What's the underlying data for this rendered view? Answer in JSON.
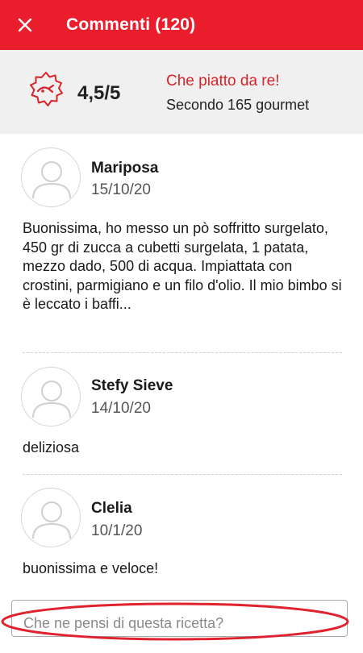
{
  "header": {
    "title": "Commenti (120)",
    "close_icon": "close-icon",
    "background": "#ea1d2c"
  },
  "rating": {
    "icon": "medal-icon",
    "value": "4,5/5",
    "phrase": "Che piatto da re!",
    "count_text": "Secondo 165 gourmet",
    "accent": "#d8232a"
  },
  "comments": [
    {
      "author": "Mariposa",
      "date": "15/10/20",
      "text": "Buonissima, ho messo un pò soffritto surgelato, 450 gr di zucca a cubetti surgelata, 1 patata, mezzo dado, 500 di acqua. Impiattata con crostini, parmigiano e un filo d'olio. Il mio bimbo si è leccato i baffi...",
      "avatar_icon": "user-avatar-icon"
    },
    {
      "author": "Stefy Sieve",
      "date": "14/10/20",
      "text": "deliziosa",
      "avatar_icon": "user-avatar-icon"
    },
    {
      "author": "Clelia",
      "date": "10/1/20",
      "text": "buonissima e veloce!",
      "avatar_icon": "user-avatar-icon"
    }
  ],
  "comment_input": {
    "placeholder": "Che ne pensi di questa ricetta?",
    "value": ""
  },
  "highlight_color": "#e0222e"
}
